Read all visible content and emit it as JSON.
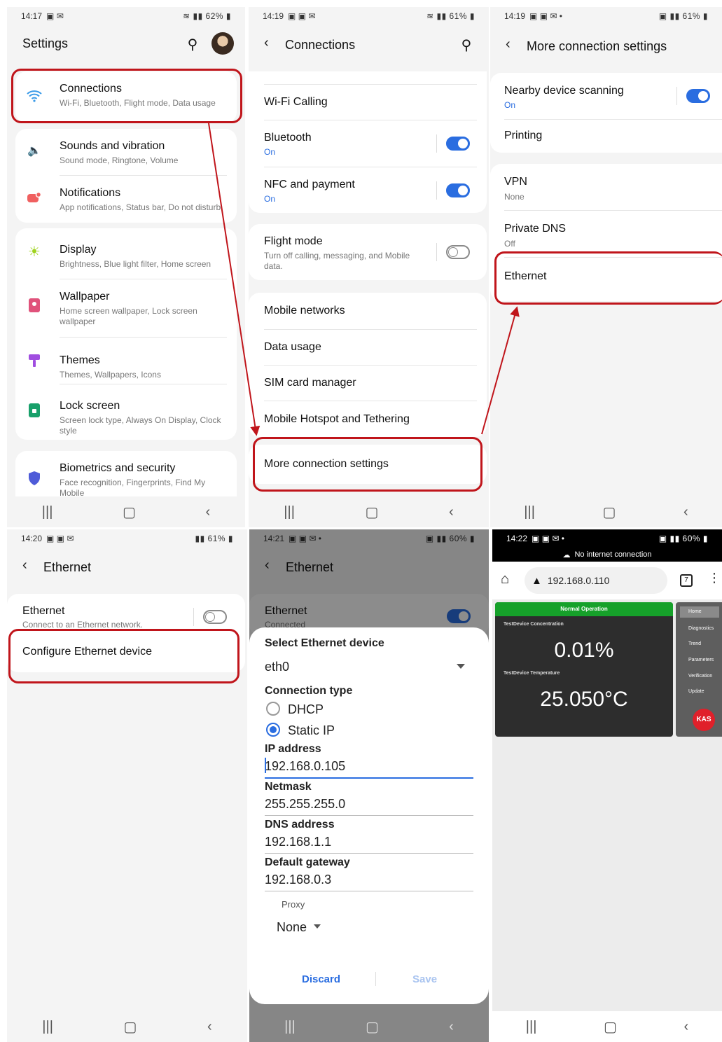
{
  "s1": {
    "time": "14:17",
    "status": "62%",
    "title": "Settings",
    "items": [
      {
        "title": "Connections",
        "sub": "Wi-Fi, Bluetooth, Flight mode, Data usage"
      },
      {
        "title": "Sounds and vibration",
        "sub": "Sound mode, Ringtone, Volume"
      },
      {
        "title": "Notifications",
        "sub": "App notifications, Status bar, Do not disturb"
      },
      {
        "title": "Display",
        "sub": "Brightness, Blue light filter, Home screen"
      },
      {
        "title": "Wallpaper",
        "sub": "Home screen wallpaper, Lock screen wallpaper"
      },
      {
        "title": "Themes",
        "sub": "Themes, Wallpapers, Icons"
      },
      {
        "title": "Lock screen",
        "sub": "Screen lock type, Always On Display, Clock style"
      },
      {
        "title": "Biometrics and security",
        "sub": "Face recognition, Fingerprints, Find My Mobile"
      }
    ]
  },
  "s2": {
    "time": "14:19",
    "status": "61%",
    "title": "Connections",
    "items": [
      {
        "title": "Wi-Fi Calling"
      },
      {
        "title": "Bluetooth",
        "sub": "On"
      },
      {
        "title": "NFC and payment",
        "sub": "On"
      },
      {
        "title": "Flight mode",
        "sub": "Turn off calling, messaging, and Mobile data."
      },
      {
        "title": "Mobile networks"
      },
      {
        "title": "Data usage"
      },
      {
        "title": "SIM card manager"
      },
      {
        "title": "Mobile Hotspot and Tethering"
      },
      {
        "title": "More connection settings"
      }
    ]
  },
  "s3": {
    "time": "14:19",
    "status": "61%",
    "title": "More connection settings",
    "items": [
      {
        "title": "Nearby device scanning",
        "sub": "On"
      },
      {
        "title": "Printing"
      },
      {
        "title": "VPN",
        "sub": "None"
      },
      {
        "title": "Private DNS",
        "sub": "Off"
      },
      {
        "title": "Ethernet"
      }
    ]
  },
  "s4": {
    "time": "14:20",
    "status": "61%",
    "title": "Ethernet",
    "items": [
      {
        "title": "Ethernet",
        "sub": "Connect to an Ethernet network."
      },
      {
        "title": "Configure Ethernet device"
      }
    ]
  },
  "s5": {
    "time": "14:21",
    "status": "60%",
    "title": "Ethernet",
    "bg_item": {
      "title": "Ethernet",
      "sub": "Connected"
    },
    "dialog": {
      "heading": "Select Ethernet device",
      "device": "eth0",
      "conn_label": "Connection type",
      "opt1": "DHCP",
      "opt2": "Static IP",
      "ip_label": "IP address",
      "ip": "192.168.0.105",
      "mask_label": "Netmask",
      "mask": "255.255.255.0",
      "dns_label": "DNS address",
      "dns": "192.168.1.1",
      "gw_label": "Default gateway",
      "gw": "192.168.0.3",
      "proxy_label": "Proxy",
      "proxy": "None",
      "discard": "Discard",
      "save": "Save"
    }
  },
  "s6": {
    "time": "14:22",
    "status": "60%",
    "banner": "No internet connection",
    "url": "192.168.0.110",
    "tabs": "7",
    "web": {
      "status": "Normal Operation",
      "l1": "TestDevice Concentration",
      "v1": "0.01%",
      "l2": "TestDevice Temperature",
      "v2": "25.050°C",
      "menu": [
        "Home",
        "Diagnostics",
        "Trend",
        "Parameters",
        "Verification",
        "Update"
      ],
      "logo": "KAS"
    }
  },
  "colors": {
    "accent": "#2a6de0",
    "highlight": "#c0151b",
    "web_green": "#16a12a"
  }
}
